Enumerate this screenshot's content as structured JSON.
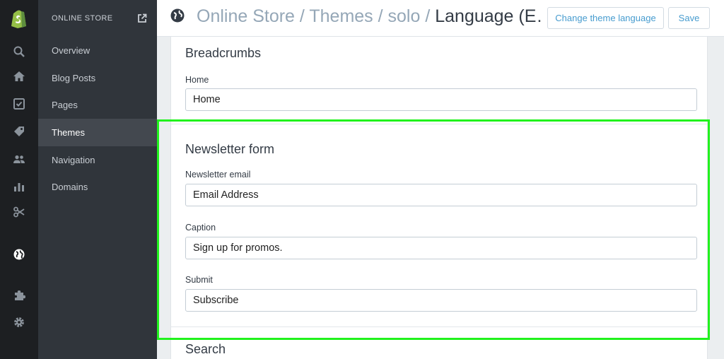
{
  "sidebar": {
    "section_label": "ONLINE STORE",
    "items": [
      {
        "label": "Overview"
      },
      {
        "label": "Blog Posts"
      },
      {
        "label": "Pages"
      },
      {
        "label": "Themes",
        "active": true
      },
      {
        "label": "Navigation"
      },
      {
        "label": "Domains"
      }
    ]
  },
  "rail_icons": [
    "shopify-logo-icon",
    "search-icon",
    "home-icon",
    "orders-icon",
    "tag-icon",
    "customers-icon",
    "reports-icon",
    "discounts-icon",
    "online-store-globe-icon",
    "apps-puzzle-icon",
    "settings-gear-icon"
  ],
  "header": {
    "crumb_1": "Online Store",
    "sep_1": " / ",
    "crumb_2": "Themes",
    "sep_2": " / ",
    "crumb_3": "solo",
    "sep_3": " / ",
    "current": "Language (E…",
    "change_language_label": "Change theme language",
    "save_label": "Save"
  },
  "sections": {
    "breadcrumbs": {
      "title": "Breadcrumbs",
      "fields": [
        {
          "label": "Home",
          "value": "Home"
        }
      ]
    },
    "newsletter": {
      "title": "Newsletter form",
      "fields": [
        {
          "label": "Newsletter email",
          "value": "Email Address"
        },
        {
          "label": "Caption",
          "value": "Sign up for promos."
        },
        {
          "label": "Submit",
          "value": "Subscribe"
        }
      ]
    },
    "search": {
      "title": "Search"
    }
  },
  "colors": {
    "accent": "#479ccf",
    "highlight": "#21f21d",
    "shopify_green": "#95bf47"
  }
}
